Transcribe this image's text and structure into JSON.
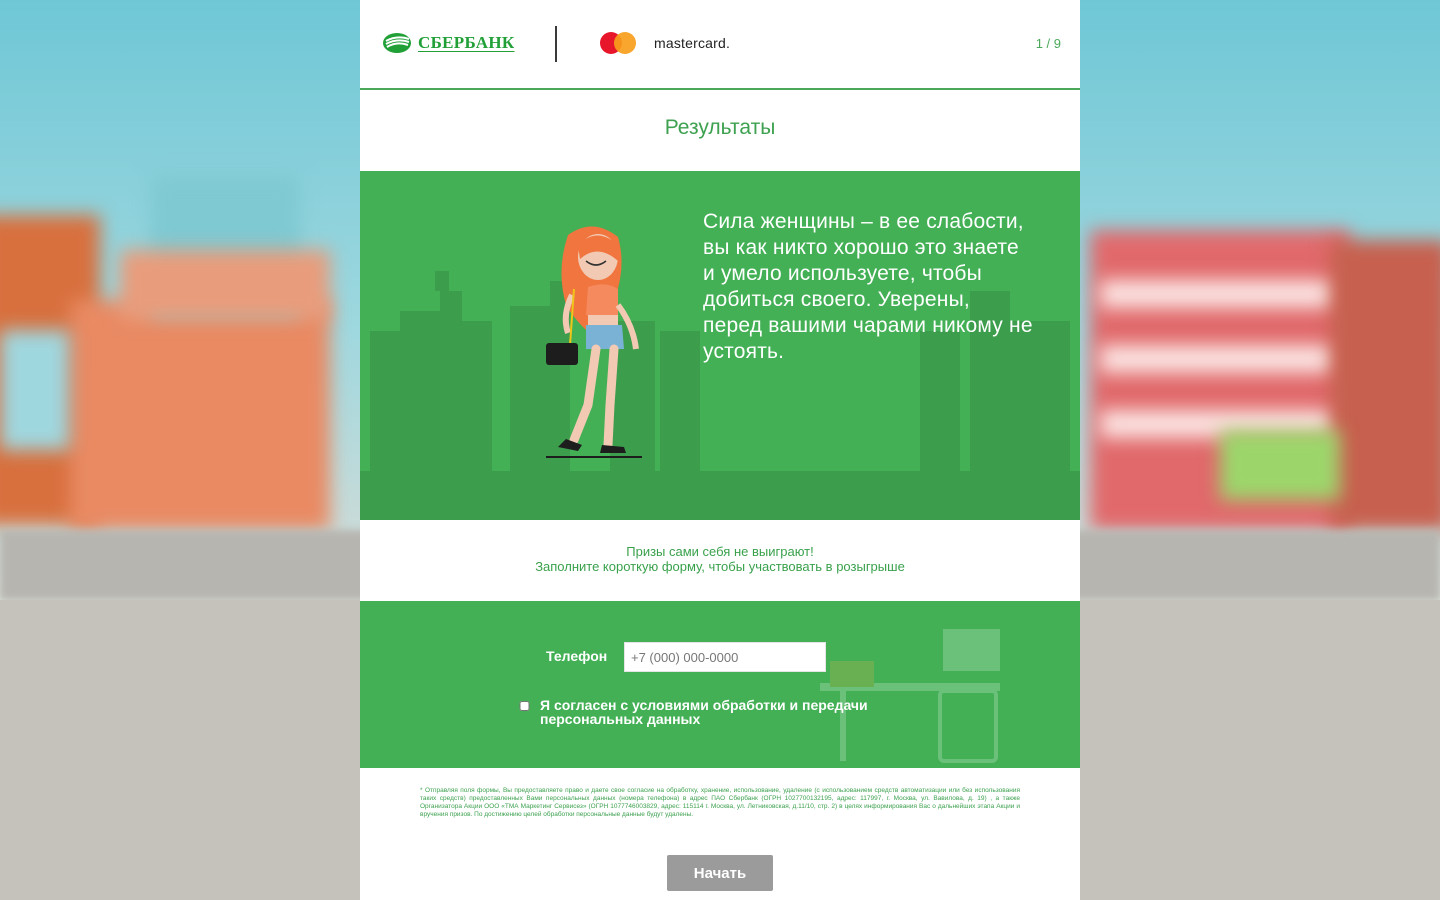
{
  "header": {
    "sber_logo_text": "СБЕРБАНК",
    "mastercard_text": "mastercard.",
    "progress": "1 / 9"
  },
  "title": "Результаты",
  "result_text": "Сила женщины – в ее слабости, вы как никто хорошо это знаете и умело используете, чтобы добиться своего. Уверены, перед вашими чарами никому не устоять.",
  "prize_line1": "Призы сами себя не выиграют!",
  "prize_line2": "Заполните короткую форму, чтобы участвовать в розыгрыше",
  "form": {
    "phone_label": "Телефон",
    "phone_placeholder": "+7 (000) 000-0000",
    "consent_label": "Я согласен с условиями обработки и передачи персональных данных"
  },
  "disclaimer": "* Отправляя поля формы, Вы предоставляете право и даете свое согласие на обработку, хранение, использование, удаление (с использованием средств автоматизации или без использования таких средств) предоставленных Вами персональных данных (номера телефона) в адрес ПАО Сбербанк (ОГРН 1027700132195, адрес: 117997, г. Москва, ул. Вавилова, д. 19) , а также Организатора Акции ООО «ТМА Маркетинг Сервисез» (ОГРН 1077746003829, адрес: 115114 г. Москва, ул. Летниковская, д.11/10, стр. 2) в целях информирования Вас о дальнейших этапа Акции и вручения призов. По достижению целей обработки персональные данные будут удалены.",
  "start_button": "Начать",
  "colors": {
    "sber_green": "#21a038",
    "panel_green": "#43b055",
    "button_gray": "#9b9b9b",
    "mastercard_red": "#e8162a",
    "mastercard_orange": "#f79e1b"
  }
}
